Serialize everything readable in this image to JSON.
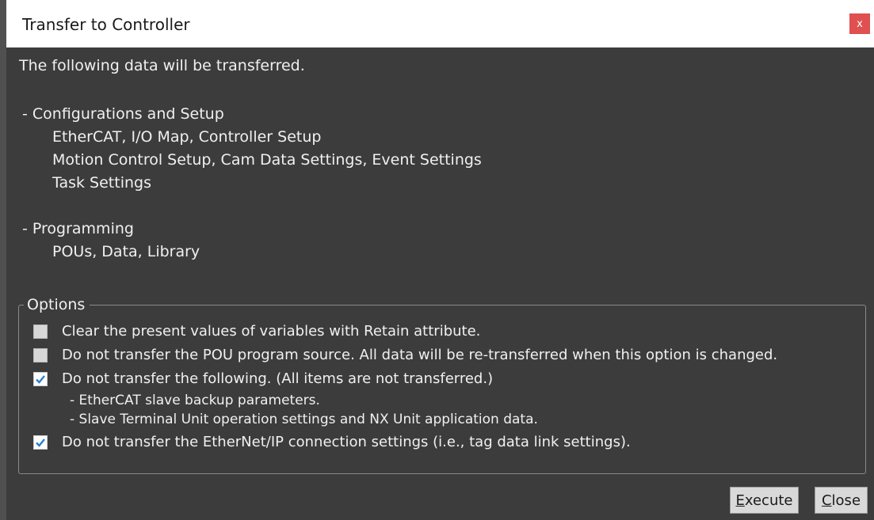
{
  "window": {
    "title": "Transfer to Controller",
    "close_glyph": "x"
  },
  "intro": "The following data will be transferred.",
  "sections": {
    "config": {
      "heading": "- Configurations and Setup",
      "items": [
        "EtherCAT, I/O Map, Controller Setup",
        "Motion Control Setup, Cam Data Settings, Event Settings",
        "Task Settings"
      ]
    },
    "programming": {
      "heading": "- Programming",
      "items": [
        "POUs, Data, Library"
      ]
    }
  },
  "options": {
    "legend": "Options",
    "items": [
      {
        "label": "Clear the present values of variables with Retain attribute.",
        "checked": false
      },
      {
        "label": "Do not transfer the POU program source. All data will be re-transferred when this option is changed.",
        "checked": false
      },
      {
        "label": "Do not transfer the following. (All items are not transferred.)",
        "checked": true,
        "subitems": [
          "- EtherCAT slave backup parameters.",
          "- Slave Terminal Unit operation settings and NX Unit application data."
        ]
      },
      {
        "label": "Do not transfer the EtherNet/IP connection settings (i.e., tag data link settings).",
        "checked": true
      }
    ]
  },
  "buttons": {
    "execute": {
      "mnemonic": "E",
      "rest": "xecute"
    },
    "close": {
      "mnemonic": "C",
      "rest": "lose"
    }
  },
  "colors": {
    "background": "#3c3c3c",
    "close_button": "#e05050",
    "checkmark": "#2a7fd4"
  },
  "icons": {
    "close": "close-icon",
    "check": "checkmark-icon"
  }
}
